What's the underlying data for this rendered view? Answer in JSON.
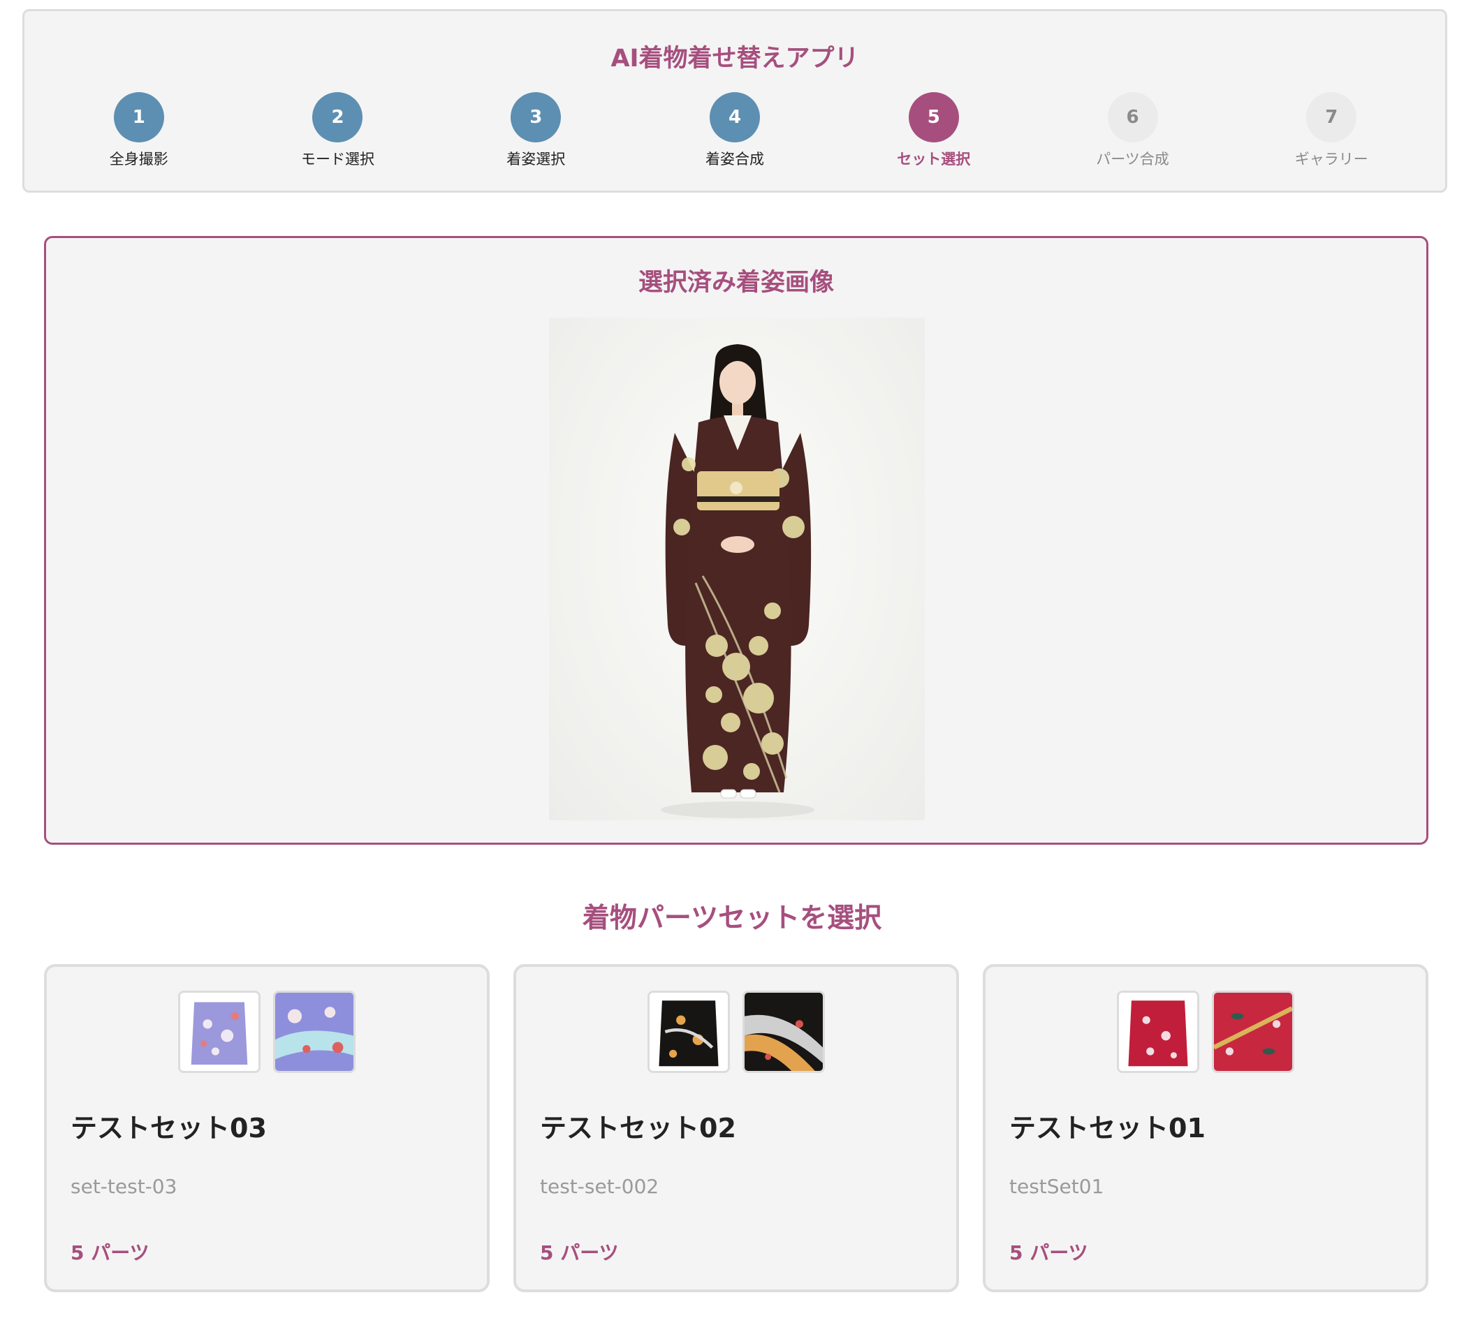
{
  "header": {
    "title": "AI着物着せ替えアプリ"
  },
  "steps": [
    {
      "number": "1",
      "label": "全身撮影",
      "state": "done"
    },
    {
      "number": "2",
      "label": "モード選択",
      "state": "done"
    },
    {
      "number": "3",
      "label": "着姿選択",
      "state": "done"
    },
    {
      "number": "4",
      "label": "着姿合成",
      "state": "done"
    },
    {
      "number": "5",
      "label": "セット選択",
      "state": "active"
    },
    {
      "number": "6",
      "label": "パーツ合成",
      "state": "pending"
    },
    {
      "number": "7",
      "label": "ギャラリー",
      "state": "pending"
    }
  ],
  "selected_image": {
    "title": "選択済み着姿画像"
  },
  "sets_section": {
    "title": "着物パーツセットを選択"
  },
  "sets": [
    {
      "name": "テストセット03",
      "id": "set-test-03",
      "parts": "5 パーツ"
    },
    {
      "name": "テストセット02",
      "id": "test-set-002",
      "parts": "5 パーツ"
    },
    {
      "name": "テストセット01",
      "id": "testSet01",
      "parts": "5 パーツ"
    }
  ],
  "colors": {
    "accent": "#a64f7e",
    "step_done": "#5d8fb2",
    "step_pending": "#ebebeb"
  }
}
